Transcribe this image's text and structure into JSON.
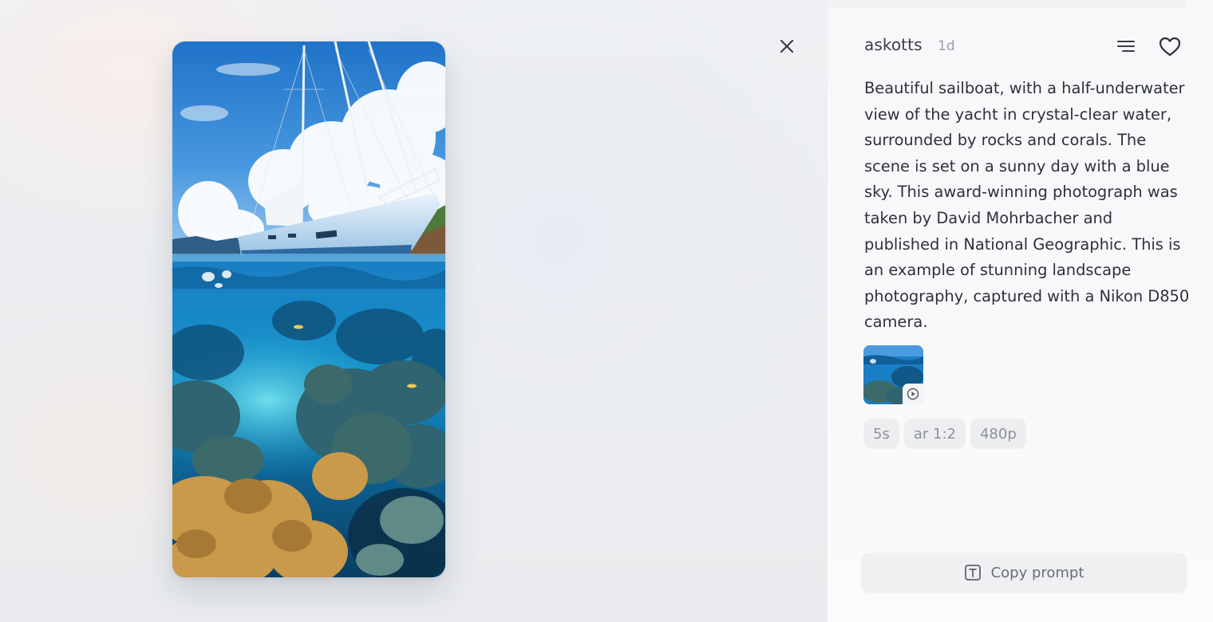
{
  "author": {
    "name": "askotts",
    "age": "1d"
  },
  "prompt": "Beautiful sailboat, with a half-underwater view of the yacht in crystal-clear water, surrounded by rocks and corals. The scene is set on a sunny day with a blue sky. This award-winning photograph was taken by David Mohrbacher and published in National Geographic. This is an example of stunning landscape photography, captured with a Nikon D850 camera.",
  "chips": [
    "5s",
    "ar 1:2",
    "480p"
  ],
  "actions": {
    "copy_label": "Copy prompt"
  },
  "icons": {
    "close": "close-icon",
    "menu": "menu-lines-icon",
    "like": "heart-icon",
    "play": "play-circle-icon",
    "copy": "text-box-icon"
  },
  "colors": {
    "text_primary": "#2e3138",
    "text_muted": "#9a9ea6",
    "chip_bg": "#edeef0",
    "panel_bg": "#f8f9fa"
  }
}
